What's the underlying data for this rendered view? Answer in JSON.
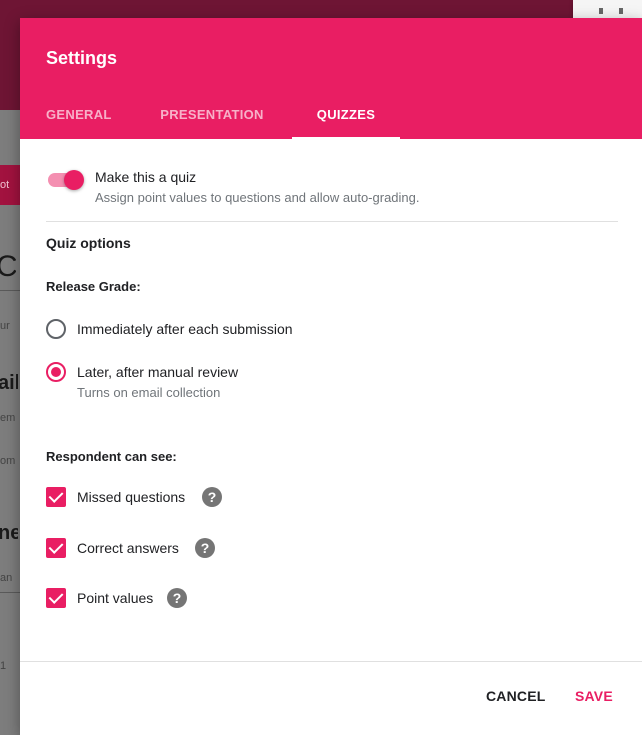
{
  "background": {
    "fragments": [
      "ot",
      "C",
      "ail",
      "ur",
      "em",
      "om",
      "ne",
      "an",
      "1"
    ]
  },
  "dialog": {
    "title": "Settings",
    "tabs": [
      {
        "label": "GENERAL",
        "active": false
      },
      {
        "label": "PRESENTATION",
        "active": false
      },
      {
        "label": "QUIZZES",
        "active": true
      }
    ],
    "quiz_toggle": {
      "label": "Make this a quiz",
      "description": "Assign point values to questions and allow auto-grading.",
      "on": true
    },
    "quiz_options_title": "Quiz options",
    "release_grade": {
      "heading": "Release Grade:",
      "options": [
        {
          "label": "Immediately after each submission",
          "selected": false
        },
        {
          "label": "Later, after manual review",
          "sublabel": "Turns on email collection",
          "selected": true
        }
      ]
    },
    "respondent": {
      "heading": "Respondent can see:",
      "items": [
        {
          "label": "Missed questions",
          "checked": true
        },
        {
          "label": "Correct answers",
          "checked": true
        },
        {
          "label": "Point values",
          "checked": true
        }
      ]
    },
    "help_glyph": "?",
    "footer": {
      "cancel_label": "CANCEL",
      "save_label": "SAVE"
    }
  },
  "colors": {
    "accent": "#e91e63",
    "accent_light": "#f48fb1",
    "header_text": "#ffffff",
    "secondary_text": "#70757a"
  },
  "icons": {
    "help": "help-circle-icon",
    "check": "checkmark-icon"
  }
}
